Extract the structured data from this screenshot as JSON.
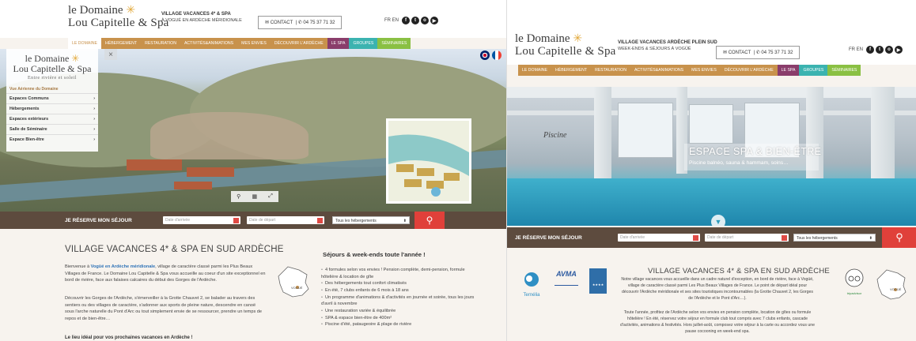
{
  "left": {
    "logo": {
      "line1": "le Domaine",
      "line2": "Lou Capitelle & Spa"
    },
    "tagline": {
      "line1": "VILLAGE VACANCES 4* & SPA",
      "line2": "À VOGUÉ EN ARDÈCHE MÉRIDIONALE"
    },
    "contact": {
      "label": "CONTACT",
      "phone": "04 75 37 71 32"
    },
    "lang": "FR EN",
    "nav": [
      "LE DOMAINE",
      "HÉBERGEMENT",
      "RESTAURATION",
      "ACTIVITÉS&ANIMATIONS",
      "MES ENVIES",
      "DÉCOUVRIR L'ARDÈCHE",
      "LE SPA",
      "GROUPES",
      "SÉMINAIRES"
    ],
    "sidemenu": {
      "logo1": "le Domaine",
      "logo2": "Lou Capitelle & Spa",
      "subtitle": "Entre rivière et soleil",
      "title": "Vue Aérienne du Domaine",
      "items": [
        "Espaces Communs",
        "Hébergements",
        "Espaces extérieurs",
        "Salle de Séminaire",
        "Espace Bien-être"
      ],
      "close": "×"
    },
    "booking": {
      "label": "JE RÉSERVE MON SÉJOUR",
      "arrival_placeholder": "Date d'arrivée",
      "departure_placeholder": "Date de départ",
      "select": "Tous les hébergements"
    },
    "title": "VILLAGE VACANCES 4* & SPA EN SUD ARDÈCHE",
    "para1_a": "Bienvenue à ",
    "para1_link": "Vogüé en Ardèche méridionale",
    "para1_b": ", village de caractère classé parmi les Plus Beaux Villages de France. Le Domaine Lou Capitelle & Spa vous accueille au coeur d'un site exceptionnel en bord de rivière, face aux falaises calcaires du début des Gorges de l'Ardèche.",
    "para2": "Découvrir les Gorges de l'Ardèche, s'émerveiller à la Grotte Chauvet 2, se balader au travers des sentiers ou des villages de caractère, s'adonner aux sports de pleine nature, descendre en canoë sous l'arche naturelle du Pont d'Arc ou tout simplement envie de se ressourcer, prendre un temps de repos et de bien-être…",
    "para3": "Le lieu idéal pour vos prochaines vacances en Ardèche !",
    "map_label": "VOGÜÉ",
    "side_title": "Séjours & week-ends toute l'année !",
    "bullets": [
      "4 formules selon vos envies ! Pension complète, demi-pension, formule hôtelière & location de gîte",
      "Des hébergements tout confort climatisés",
      "En été, 7 clubs enfants de 6 mois à 18 ans",
      "Un programme d'animations & d'activités en journée et soirée, tous les jours d'avril à novembre",
      "Une restauration variée & équilibrée",
      "SPA & espace bien-être de 400m²",
      "Piscine d'été, pataugeoire & plage de rivière"
    ]
  },
  "right": {
    "logo": {
      "line1": "le Domaine",
      "line2": "Lou Capitelle & Spa"
    },
    "tagline": {
      "line1": "VILLAGE VACANCES ARDÈCHE PLEIN SUD",
      "line2": "WEEK-ENDS & SÉJOURS À VOGÜÉ"
    },
    "contact": {
      "label": "CONTACT",
      "phone": "04 75 37 71 32"
    },
    "lang": "FR EN",
    "nav": [
      "LE DOMAINE",
      "HÉBERGEMENT",
      "RESTAURATION",
      "ACTIVITÉS&ANIMATIONS",
      "MES ENVIES",
      "DÉCOUVRIR L'ARDÈCHE",
      "LE SPA",
      "GROUPES",
      "SÉMINAIRES"
    ],
    "hero": {
      "piscine": "Piscine",
      "title": "ESPACE SPA & BIEN-ÊTRE",
      "subtitle": "Piscine balnéo, sauna & hammam, soins…"
    },
    "booking": {
      "label": "JE RÉSERVE MON SÉJOUR",
      "arrival_placeholder": "Date d'arrivée",
      "departure_placeholder": "Date de départ",
      "select": "Tous les hébergements"
    },
    "title": "VILLAGE VACANCES 4* & SPA EN SUD ARDÈCHE",
    "para1": "Notre village vacances vous accueille dans un cadre naturel d'exception, en bord de rivière, face à Vogüé, village de caractère classé parmi Les Plus Beaux Villages de France. Le point de départ idéal pour découvrir l'Ardèche méridionale et ses sites touristiques incontournables (la Grotte Chauvet 2, les Gorges de l'Ardèche et le Pont d'Arc…).",
    "para2": "Toute l'année, profitez de l'Ardèche selon vos envies en pension complète, location de gîtes ou formule hôtelière ! En été, réservez votre séjour en formule club tout compris avec 7 clubs enfants, cascade d'activités, animations & festivités. Hors juillet-août, composez votre séjour à la carte ou accordez vous une pause cocooning en week-end spa.",
    "logos": {
      "ternelia": "Ternélia",
      "avma": "AVMA",
      "tripadvisor": "tripadvisor",
      "vogue": "VOGÜÉ"
    }
  },
  "colors": {
    "nav": "#c8924c",
    "spa": "#8a3d6b",
    "groups": "#3bb3b0",
    "seminars": "#8ac043",
    "booking_bar": "#5d4b3e",
    "cta": "#e0403a",
    "link": "#2f73b7"
  }
}
